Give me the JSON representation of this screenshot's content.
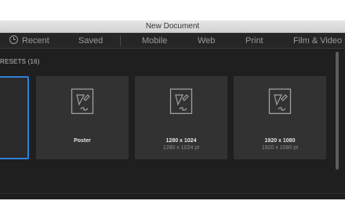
{
  "window": {
    "title": "New Document"
  },
  "tabs": [
    {
      "label": "Recent"
    },
    {
      "label": "Saved"
    },
    {
      "label": "Mobile"
    },
    {
      "label": "Web"
    },
    {
      "label": "Print"
    },
    {
      "label": "Film & Video"
    }
  ],
  "section": {
    "label": "RESETS",
    "count": "(16)"
  },
  "presets": [
    {
      "name": "",
      "size": ""
    },
    {
      "name": "Poster",
      "size": ""
    },
    {
      "name": "1280 x 1024",
      "size": "1280 x 1024 pt"
    },
    {
      "name": "1920 x 1080",
      "size": "1920 x 1080 pt"
    }
  ],
  "icons": {
    "recent": "clock-icon",
    "preset": "document-pen-icon"
  },
  "colors": {
    "accent": "#2f7fd6",
    "background": "#1f1f1f",
    "card": "#323232"
  }
}
